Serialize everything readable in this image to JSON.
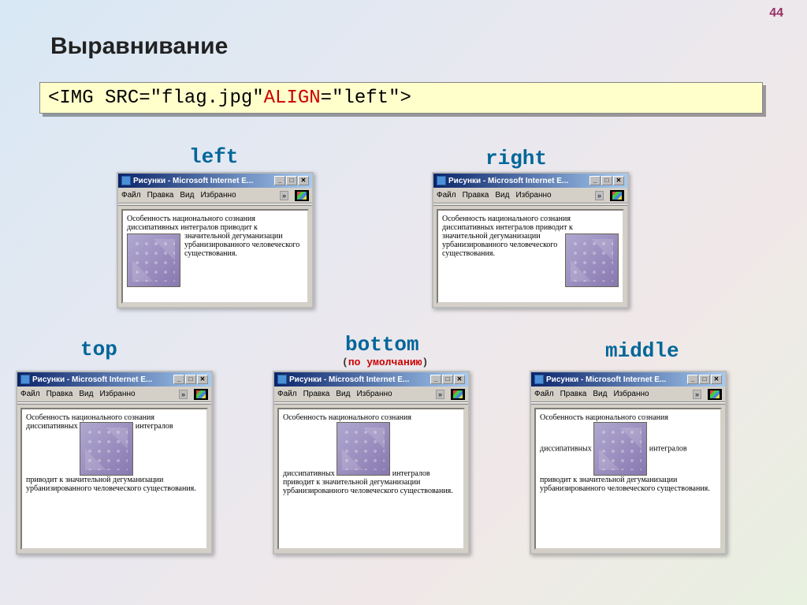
{
  "page_number": "44",
  "title": "Выравнивание",
  "code": {
    "prefix": "<IMG SRC=\"flag.jpg\" ",
    "attr": "ALIGN",
    "suffix": "=\"left\">"
  },
  "labels": {
    "left": "left",
    "right": "right",
    "top": "top",
    "bottom": "bottom",
    "bottom_sub": "по умолчанию",
    "middle": "middle"
  },
  "browser": {
    "title": "Рисунки - Microsoft Internet E...",
    "menu": {
      "file": "Файл",
      "edit": "Правка",
      "view": "Вид",
      "fav": "Избранно",
      "chevron": "»"
    },
    "winbtns": {
      "min": "_",
      "max": "□",
      "close": "✕"
    }
  },
  "text": {
    "full": "Особенность национального сознания диссипативных интегралов приводит к значительной дегуманизации урбанизированного человеческого существования.",
    "lr_before": "Особенность национального сознания диссипативных интегралов приводит к ",
    "lr_wrap": "значительной дегуманизации урбанизированного человеческого ",
    "lr_after": "существования.",
    "tbm_line1": "Особенность национального сознания",
    "top_before": "диссипативных",
    "top_after": "интегралов",
    "bottom_before": "диссипативных",
    "bottom_after": "интегралов",
    "middle_before": "диссипативных",
    "middle_after": "интегралов",
    "tbm_tail": "приводит к значительной дегуманизации урбанизированного человеческого существования."
  }
}
